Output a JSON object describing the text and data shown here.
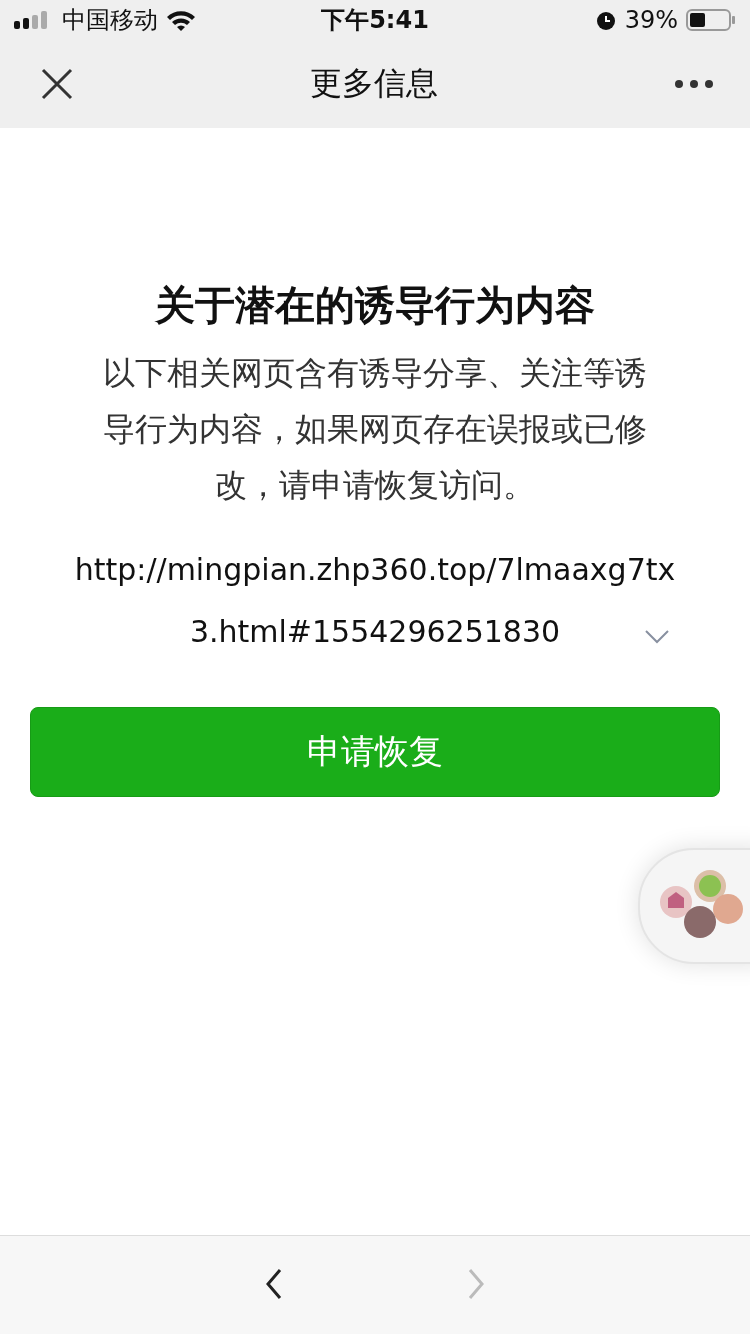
{
  "status_bar": {
    "carrier": "中国移动",
    "time": "下午5:41",
    "battery": "39%"
  },
  "nav_bar": {
    "title": "更多信息"
  },
  "notice": {
    "title": "关于潜在的诱导行为内容",
    "body": "以下相关网页含有诱导分享、关注等诱导行为内容，如果网页存在误报或已修改，请申请恢复访问。",
    "url_lines": [
      "http://mingpian.zhp360.top/7lmaaxg7tx",
      "3.html#1554296251830"
    ]
  },
  "button": {
    "label": "申请恢复"
  },
  "toolbar": [
    {
      "kind": "back",
      "disabled": false
    },
    {
      "kind": "forward",
      "disabled": true
    }
  ]
}
